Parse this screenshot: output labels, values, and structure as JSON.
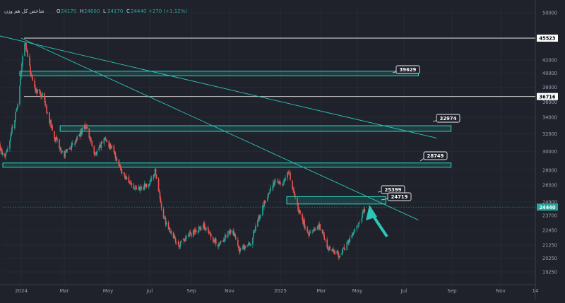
{
  "header": {
    "symbol": "شاخص کل هم وزن",
    "ohlc_labels": [
      "O",
      "H",
      "L",
      "C"
    ],
    "ohlc_values": [
      "24170",
      "24600",
      "24170",
      "24440"
    ],
    "change": "+270 (+1.12%)"
  },
  "colors": {
    "background": "#1f222b",
    "up": "#26a69a",
    "down": "#ef5350",
    "zone_fill": "#1e6f68",
    "zone_stroke": "#2bd6c2",
    "trendline": "#2ec4b6",
    "axis_text": "#9aa0ab"
  },
  "chart_data": {
    "type": "candlestick",
    "y_scale": "log",
    "y_ticks": [
      "50000",
      "45523",
      "42000",
      "40000",
      "38000",
      "36716",
      "36000",
      "34000",
      "32000",
      "30000",
      "28000",
      "26500",
      "24900",
      "24440",
      "23700",
      "22450",
      "21250",
      "20250",
      "19250"
    ],
    "x_ticks": [
      "2024",
      "Mar",
      "May",
      "Jul",
      "Sep",
      "Nov",
      "2025",
      "Mar",
      "May",
      "Jul",
      "Sep",
      "Nov",
      "14"
    ],
    "last_price": 24440,
    "horizontal_levels": [
      45523,
      36716
    ],
    "zones": [
      {
        "label": "39629",
        "low": 39629,
        "high": 40300,
        "start": "2023-12-30",
        "end": "2025-07-15"
      },
      {
        "label": "32974",
        "low": 32300,
        "high": 32974,
        "start": "2024-02-25",
        "end": "2025-08-30"
      },
      {
        "label": "28749",
        "low": 28300,
        "high": 28749,
        "start": "2023-11-10",
        "end": "2025-08-30"
      },
      {
        "label": "25399",
        "low": 24719,
        "high": 25399,
        "start": "2025-01-10",
        "end": "2025-05-30"
      }
    ],
    "zone_labels": [
      "39629",
      "32974",
      "28749",
      "25399",
      "24719"
    ],
    "trendlines": [
      {
        "from": [
          "2023-11-10",
          46500
        ],
        "to": [
          "2025-08-10",
          31500
        ]
      },
      {
        "from": [
          "2024-01-01",
          45523
        ],
        "to": [
          "2025-07-15",
          23300
        ]
      }
    ],
    "ohlc_path": [
      [
        "2023-11-10",
        29000
      ],
      [
        "2023-11-25",
        31000
      ],
      [
        "2023-12-10",
        29400
      ],
      [
        "2023-12-28",
        36000
      ],
      [
        "2024-01-05",
        45523
      ],
      [
        "2024-01-18",
        38000
      ],
      [
        "2024-02-01",
        36716
      ],
      [
        "2024-02-15",
        32000
      ],
      [
        "2024-03-01",
        29500
      ],
      [
        "2024-03-20",
        31500
      ],
      [
        "2024-04-01",
        33000
      ],
      [
        "2024-04-15",
        29500
      ],
      [
        "2024-04-28",
        31500
      ],
      [
        "2024-05-10",
        30000
      ],
      [
        "2024-05-25",
        27500
      ],
      [
        "2024-06-10",
        26000
      ],
      [
        "2024-06-28",
        26500
      ],
      [
        "2024-07-08",
        28000
      ],
      [
        "2024-07-20",
        23500
      ],
      [
        "2024-08-10",
        21200
      ],
      [
        "2024-08-25",
        22000
      ],
      [
        "2024-09-15",
        22800
      ],
      [
        "2024-10-05",
        21300
      ],
      [
        "2024-10-25",
        22500
      ],
      [
        "2024-11-05",
        20800
      ],
      [
        "2024-11-20",
        21500
      ],
      [
        "2024-12-10",
        25000
      ],
      [
        "2024-12-25",
        27000
      ],
      [
        "2025-01-05",
        26500
      ],
      [
        "2025-01-12",
        28000
      ],
      [
        "2025-01-25",
        24500
      ],
      [
        "2025-02-10",
        22000
      ],
      [
        "2025-02-25",
        22800
      ],
      [
        "2025-03-10",
        21000
      ],
      [
        "2025-03-25",
        20500
      ],
      [
        "2025-04-05",
        21300
      ],
      [
        "2025-04-20",
        22800
      ],
      [
        "2025-05-01",
        24440
      ]
    ]
  }
}
